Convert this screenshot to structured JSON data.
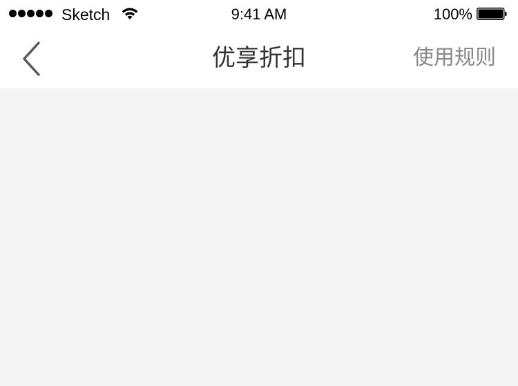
{
  "status_bar": {
    "carrier": "Sketch",
    "time": "9:41 AM",
    "battery_percent": "100%",
    "battery_level": 1.0,
    "signal_bars": 5
  },
  "nav": {
    "back_icon": "chevron-left-icon",
    "title": "优享折扣",
    "rules_label": "使用规则"
  },
  "colors": {
    "nav_background": "#ffffff",
    "page_background": "#f4f4f4",
    "title_text": "#333333",
    "rules_text": "#888888"
  }
}
